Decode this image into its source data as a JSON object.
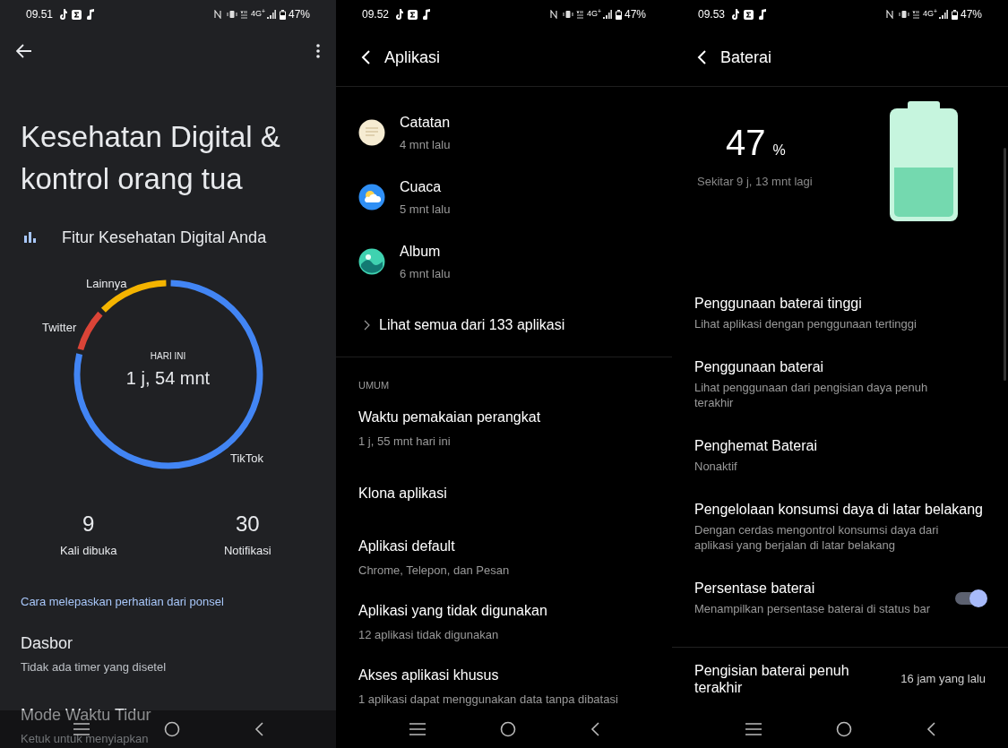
{
  "wellbeing_screen": {
    "status_bar": {
      "time": "09.51",
      "network": "4G$^{+}$",
      "battery": "47%"
    },
    "title": "Kesehatan Digital & kontrol orang tua",
    "section_title": "Fitur Kesehatan Digital Anda",
    "usage_ring": {
      "caption": "HARI INI",
      "total": "1 j, 54 mnt",
      "segments": [
        {
          "label": "TikTok",
          "color": "#4285f4"
        },
        {
          "label": "Twitter",
          "color": "#db4437"
        },
        {
          "label": "Lainnya",
          "color": "#f4b400"
        }
      ]
    },
    "stats": [
      {
        "value": "9",
        "label": "Kali dibuka"
      },
      {
        "value": "30",
        "label": "Notifikasi"
      }
    ],
    "link": "Cara melepaskan perhatian dari ponsel",
    "items": [
      {
        "title": "Dasbor",
        "subtitle": "Tidak ada timer yang disetel"
      },
      {
        "title": "Mode Waktu Tidur",
        "subtitle": "Ketuk untuk menyiapkan"
      }
    ]
  },
  "apps_screen": {
    "status_bar": {
      "time": "09.52",
      "network": "4G$^{+}$",
      "battery": "47%"
    },
    "title": "Aplikasi",
    "recent_apps": [
      {
        "kind": "notes",
        "name": "Catatan",
        "time": "4 mnt lalu"
      },
      {
        "kind": "weather",
        "name": "Cuaca",
        "time": "5 mnt lalu"
      },
      {
        "kind": "album",
        "name": "Album",
        "time": "6 mnt lalu"
      }
    ],
    "see_all": "Lihat semua dari 133 aplikasi",
    "section_label": "UMUM",
    "items": [
      {
        "title": "Waktu pemakaian perangkat",
        "subtitle": "1 j, 55 mnt hari ini"
      },
      {
        "title": "Klona aplikasi"
      },
      {
        "title": "Aplikasi default",
        "subtitle": "Chrome, Telepon, dan Pesan"
      },
      {
        "title": "Aplikasi yang tidak digunakan",
        "subtitle": "12 aplikasi tidak digunakan"
      },
      {
        "title": "Akses aplikasi khusus",
        "subtitle": "1 aplikasi dapat menggunakan data tanpa dibatasi"
      }
    ]
  },
  "battery_screen": {
    "status_bar": {
      "time": "09.53",
      "network": "4G$^{+}$",
      "battery": "47%"
    },
    "title": "Baterai",
    "percent": "47",
    "percent_sign": "%",
    "remaining": "Sekitar 9 j, 13 mnt lagi",
    "battery_gauge": {
      "level": 0.47
    },
    "items": [
      {
        "kind": "plain",
        "title": "Penggunaan baterai tinggi",
        "subtitle": "Lihat aplikasi dengan penggunaan tertinggi"
      },
      {
        "kind": "plain",
        "title": "Penggunaan baterai",
        "subtitle": "Lihat penggunaan dari pengisian daya penuh terakhir"
      },
      {
        "kind": "plain",
        "title": "Penghemat Baterai",
        "subtitle": "Nonaktif"
      },
      {
        "kind": "plain",
        "title": "Pengelolaan konsumsi daya di latar belakang",
        "subtitle": "Dengan cerdas mengontrol konsumsi daya dari aplikasi yang berjalan di latar belakang"
      },
      {
        "kind": "toggle",
        "title": "Persentase baterai",
        "subtitle": "Menampilkan persentase baterai di status bar",
        "on": true
      },
      {
        "kind": "value",
        "title": "Pengisian baterai penuh terakhir",
        "value": "16 jam yang lalu"
      }
    ]
  }
}
